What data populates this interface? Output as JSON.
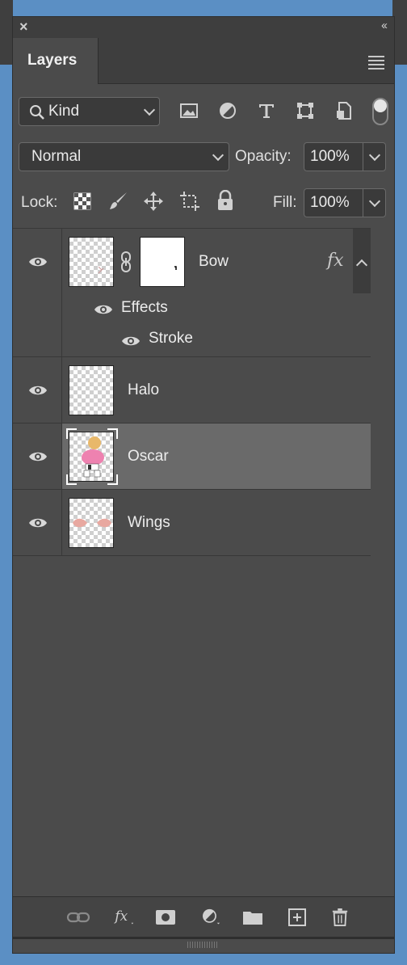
{
  "panel": {
    "tab_label": "Layers",
    "close_glyph": "×",
    "collapse_glyph": "‹‹"
  },
  "filter": {
    "kind_label": "Kind",
    "icons": [
      "search-icon",
      "image-filter-icon",
      "adjustment-filter-icon",
      "type-filter-icon",
      "shape-filter-icon",
      "smart-object-filter-icon"
    ]
  },
  "blend": {
    "mode": "Normal",
    "opacity_label": "Opacity:",
    "opacity_value": "100%"
  },
  "lock": {
    "label": "Lock:",
    "fill_label": "Fill:",
    "fill_value": "100%",
    "icons": [
      "lock-transparent-icon",
      "lock-paint-icon",
      "lock-position-icon",
      "lock-artboard-icon",
      "lock-all-icon"
    ]
  },
  "layers": [
    {
      "name": "Bow",
      "fx": "fx",
      "effects_label": "Effects",
      "effect_items": [
        "Stroke"
      ],
      "has_mask": true
    },
    {
      "name": "Halo"
    },
    {
      "name": "Oscar",
      "selected": true
    },
    {
      "name": "Wings"
    }
  ],
  "colors": {
    "panel_bg": "#4b4b4b",
    "selected_row": "#6a6a6a",
    "desktop": "#5b8fc4"
  },
  "bottom_icons": [
    "link-layers-icon",
    "add-style-icon",
    "add-mask-icon",
    "new-adjustment-icon",
    "new-group-icon",
    "new-layer-icon",
    "delete-layer-icon"
  ]
}
